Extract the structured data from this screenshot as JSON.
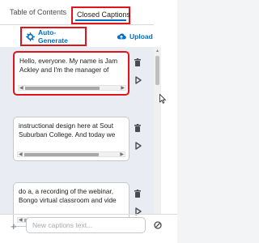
{
  "tabs": [
    {
      "label": "Table of Contents",
      "active": false
    },
    {
      "label": "Closed Captions",
      "active": true
    }
  ],
  "actions": {
    "auto_generate": "Auto-Generate",
    "upload": "Upload"
  },
  "captions": [
    {
      "text": "Hello, everyone. My name is Jam\nAckley and I'm the manager of",
      "highlighted": true
    },
    {
      "text": "instructional design here at Sout\nSuburban College. And today we",
      "highlighted": false
    },
    {
      "text": "do a, a recording of the webinar,\nBongo virtual classroom and vide",
      "highlighted": false
    }
  ],
  "new_caption": {
    "value": "",
    "placeholder": "New captions text..."
  },
  "colors": {
    "accent": "#006fbf",
    "highlight": "#e1141c",
    "list_background": "#e9ecf3"
  }
}
